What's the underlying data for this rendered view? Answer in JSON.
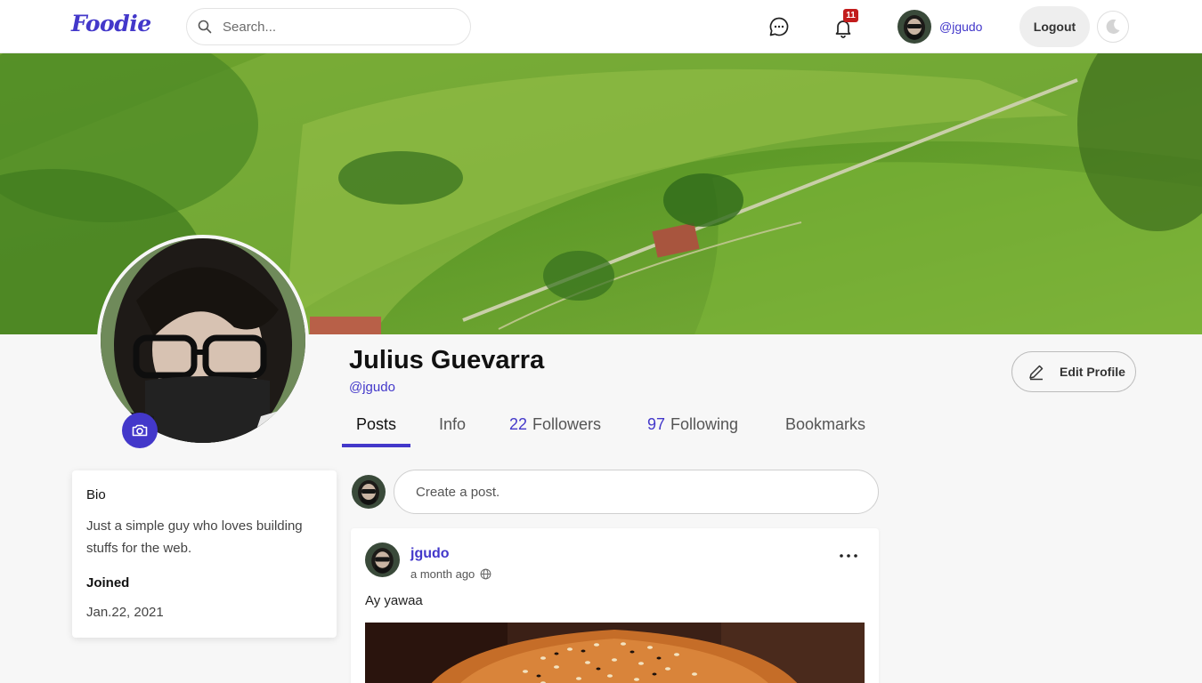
{
  "navbar": {
    "logo": "Foodie",
    "search_placeholder": "Search...",
    "notification_count": "11",
    "user_handle": "@jgudo",
    "logout_label": "Logout"
  },
  "profile": {
    "name": "Julius Guevarra",
    "handle": "@jgudo",
    "edit_label": "Edit Profile"
  },
  "tabs": {
    "posts": "Posts",
    "info": "Info",
    "followers_count": "22",
    "followers_label": "Followers",
    "following_count": "97",
    "following_label": "Following",
    "bookmarks": "Bookmarks"
  },
  "bio": {
    "title": "Bio",
    "text": "Just a simple guy who loves building stuffs for the web.",
    "joined_title": "Joined",
    "joined_date": "Jan.22, 2021"
  },
  "create_post": {
    "placeholder": "Create a post."
  },
  "post": {
    "author": "jgudo",
    "time": "a month ago",
    "text": "Ay yawaa"
  },
  "colors": {
    "accent": "#4338ca",
    "badge": "#c21d1d",
    "background": "#f7f7f7"
  }
}
